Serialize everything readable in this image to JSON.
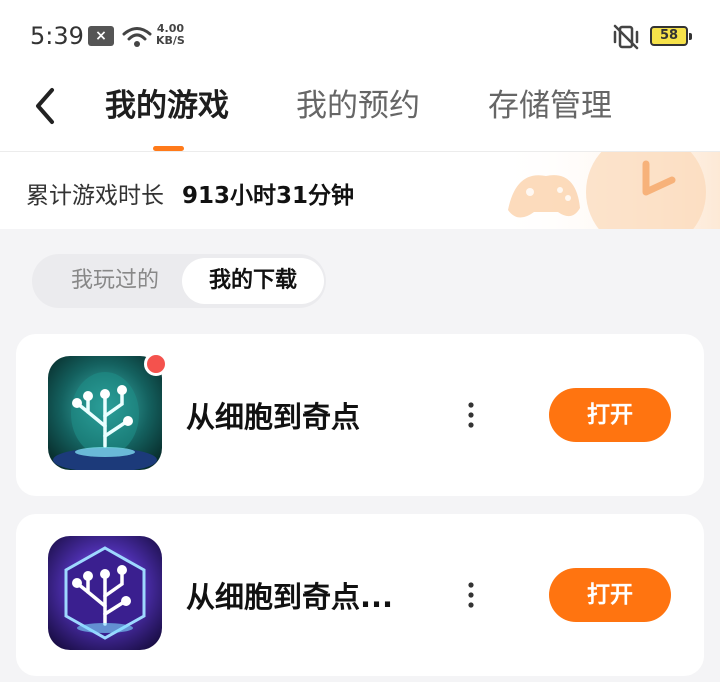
{
  "status_bar": {
    "time": "5:39",
    "speed_value": "4.00",
    "speed_unit": "KB/S",
    "battery": "58",
    "notification_icon": "close-box-icon",
    "wifi_icon": "wifi-icon",
    "mute_icon": "vibrate-off-icon"
  },
  "header": {
    "back_icon": "chevron-left-icon",
    "tabs": [
      {
        "label": "我的游戏",
        "active": true
      },
      {
        "label": "我的预约",
        "active": false
      },
      {
        "label": "存储管理",
        "active": false
      }
    ]
  },
  "playtime": {
    "label": "累计游戏时长",
    "value": "913小时31分钟"
  },
  "segment": {
    "items": [
      {
        "label": "我玩过的",
        "active": false
      },
      {
        "label": "我的下载",
        "active": true
      }
    ]
  },
  "games": [
    {
      "name": "从细胞到奇点",
      "action": "打开",
      "has_badge": true,
      "icon": "cell-to-singularity-app-icon",
      "more_icon": "more-vertical-icon"
    },
    {
      "name": "从细胞到奇点...",
      "action": "打开",
      "has_badge": false,
      "icon": "cell-to-singularity-app-icon",
      "more_icon": "more-vertical-icon"
    }
  ],
  "colors": {
    "accent": "#ff7410",
    "badge": "#f4524d",
    "background": "#f4f4f6"
  }
}
